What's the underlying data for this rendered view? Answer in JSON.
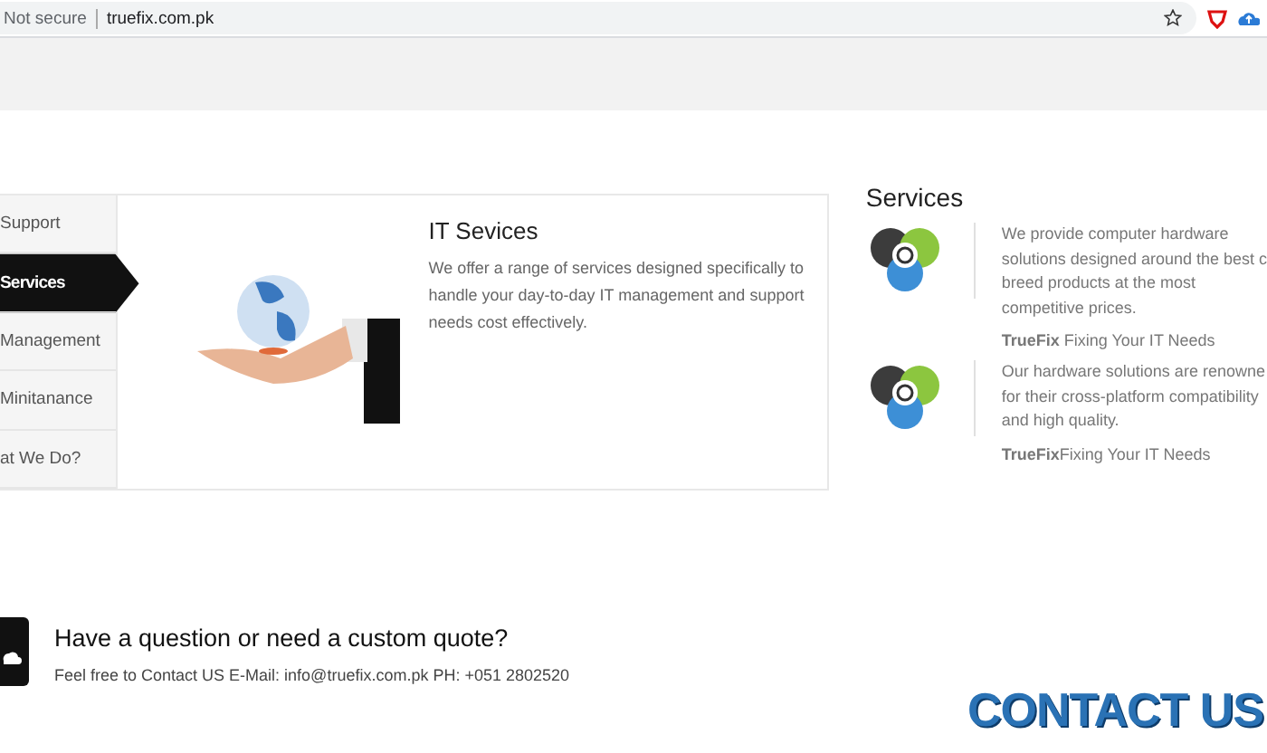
{
  "browser": {
    "security": "Not secure",
    "url": "truefix.com.pk"
  },
  "tabs": [
    {
      "label": "Support",
      "selected": false
    },
    {
      "label": "Services",
      "selected": true
    },
    {
      "label": "Management",
      "selected": false
    },
    {
      "label": "Minitanance",
      "selected": false
    },
    {
      "label": "at We Do?",
      "selected": false
    }
  ],
  "panel": {
    "kind": "picture",
    "title": "IT Sevices",
    "text": "We offer a range of services designed specifically to handle your day-to-day IT management and support needs cost effectively."
  },
  "services": {
    "title": "Services",
    "items": [
      {
        "lines": [
          "We provide computer hardware",
          "solutions designed around the best c",
          "breed products at the most",
          "competitive prices."
        ],
        "brand": "TrueFix",
        "tagline": " Fixing Your IT Needs"
      },
      {
        "lines": [
          "Our hardware solutions are renowne",
          "for their cross-platform compatibility",
          "and high quality."
        ],
        "brand": "TrueFix",
        "tagline": "Fixing Your IT Needs"
      }
    ]
  },
  "contact": {
    "heading": "Have a question or need a custom quote?",
    "text": "Feel free to Contact US E-Mail: info@truefix.com.pk PH: +051 2802520",
    "logo": "CONTACT US"
  }
}
